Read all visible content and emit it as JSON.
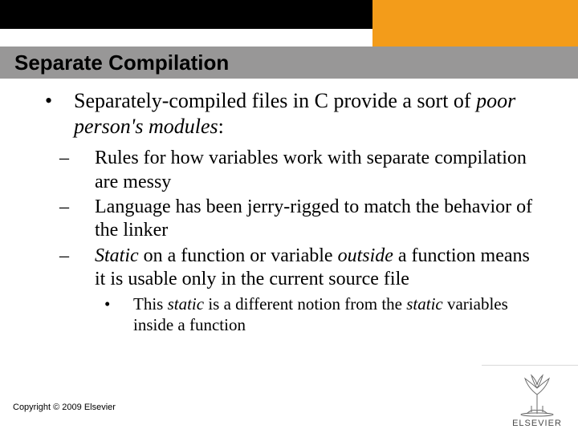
{
  "title": "Separate Compilation",
  "bullet1": {
    "pre": "Separately-compiled files in C provide a sort of ",
    "em": "poor person's modules",
    "post": ":"
  },
  "sub1": "Rules for how variables work with separate compilation are messy",
  "sub2": "Language has been jerry-rigged to match the behavior of the linker",
  "sub3": {
    "w1": "Static",
    "t1": " on a function or variable ",
    "w2": "outside",
    "t2": " a function means it is usable only in the current source file"
  },
  "subsub": {
    "t1": "This ",
    "w1": "static",
    "t2": " is a different notion from the ",
    "w2": "static",
    "t3": " variables inside a function"
  },
  "copyright": "Copyright © 2009 Elsevier",
  "logo": "ELSEVIER"
}
